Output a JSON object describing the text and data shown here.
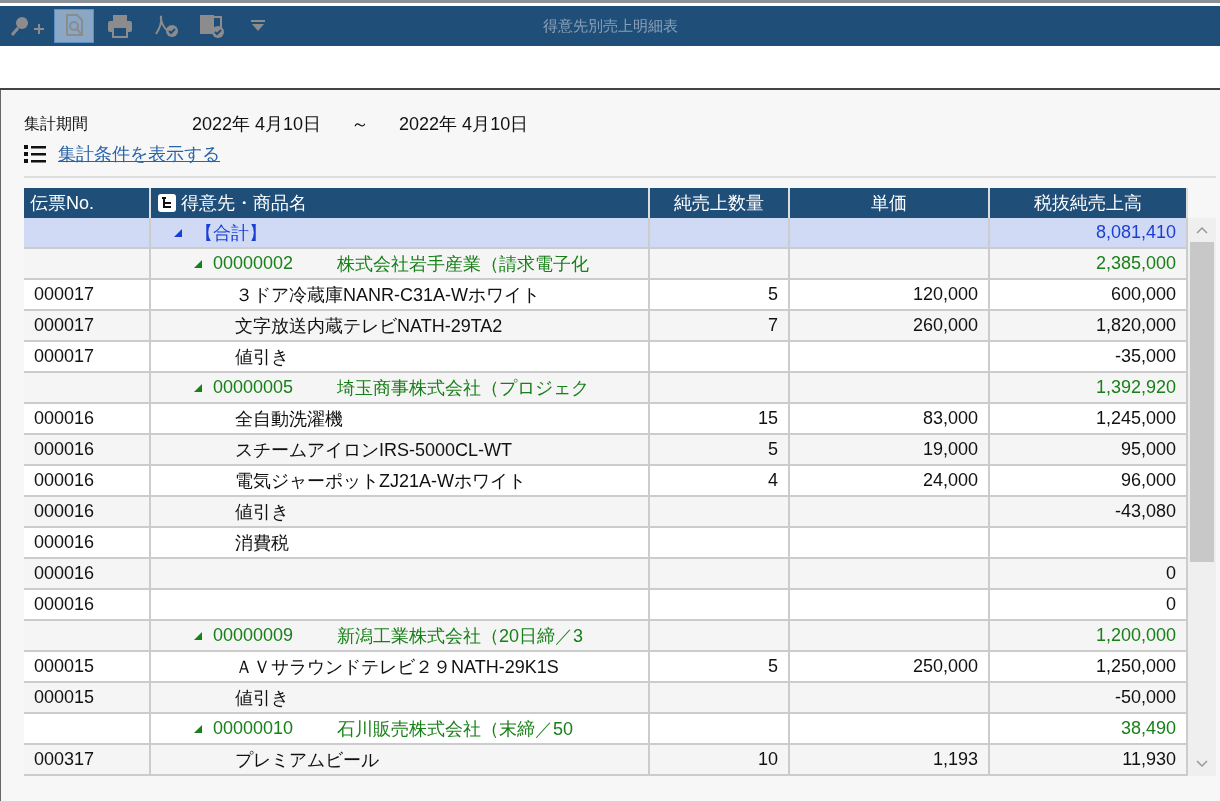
{
  "window": {
    "title": "得意先別売上明細表"
  },
  "toolbar": [
    {
      "kind": "zoom",
      "selected": false
    },
    {
      "kind": "preview",
      "selected": true
    },
    {
      "kind": "print",
      "selected": false
    },
    {
      "kind": "pdf",
      "selected": false
    },
    {
      "kind": "excel",
      "selected": false
    },
    {
      "kind": "more",
      "selected": false
    }
  ],
  "period": {
    "label": "集計期間",
    "from": "2022年  4月10日",
    "separator": "～",
    "to": "2022年  4月10日"
  },
  "conditions_link": "集計条件を表示する",
  "table": {
    "columns": [
      "伝票No.",
      "得意先・商品名",
      "純売上数量",
      "単価",
      "税抜純売上高"
    ],
    "rows": [
      {
        "kind": "total",
        "slip": "",
        "code": "",
        "name": "【合計】",
        "qty": "",
        "price": "",
        "amount": "8,081,410",
        "expanded": true
      },
      {
        "kind": "group",
        "slip": "",
        "code": "00000002",
        "name": "株式会社岩手産業（請求電子化",
        "qty": "",
        "price": "",
        "amount": "2,385,000",
        "expanded": true
      },
      {
        "kind": "item",
        "slip": "000017",
        "code": "",
        "name": "３ドア冷蔵庫NANR-C31A-Wホワイト",
        "qty": "5",
        "price": "120,000",
        "amount": "600,000"
      },
      {
        "kind": "item",
        "slip": "000017",
        "code": "",
        "name": "文字放送内蔵テレビNATH-29TA2",
        "qty": "7",
        "price": "260,000",
        "amount": "1,820,000"
      },
      {
        "kind": "item",
        "slip": "000017",
        "code": "",
        "name": "値引き",
        "qty": "",
        "price": "",
        "amount": "-35,000"
      },
      {
        "kind": "group",
        "slip": "",
        "code": "00000005",
        "name": "埼玉商事株式会社（プロジェク",
        "qty": "",
        "price": "",
        "amount": "1,392,920",
        "expanded": true
      },
      {
        "kind": "item",
        "slip": "000016",
        "code": "",
        "name": "全自動洗濯機",
        "qty": "15",
        "price": "83,000",
        "amount": "1,245,000"
      },
      {
        "kind": "item",
        "slip": "000016",
        "code": "",
        "name": "スチームアイロンIRS-5000CL-WT",
        "qty": "5",
        "price": "19,000",
        "amount": "95,000"
      },
      {
        "kind": "item",
        "slip": "000016",
        "code": "",
        "name": "電気ジャーポットZJ21A-Wホワイト",
        "qty": "4",
        "price": "24,000",
        "amount": "96,000"
      },
      {
        "kind": "item",
        "slip": "000016",
        "code": "",
        "name": "値引き",
        "qty": "",
        "price": "",
        "amount": "-43,080"
      },
      {
        "kind": "item",
        "slip": "000016",
        "code": "",
        "name": "消費税",
        "qty": "",
        "price": "",
        "amount": ""
      },
      {
        "kind": "item",
        "slip": "000016",
        "code": "",
        "name": "",
        "qty": "",
        "price": "",
        "amount": "0"
      },
      {
        "kind": "item",
        "slip": "000016",
        "code": "",
        "name": "",
        "qty": "",
        "price": "",
        "amount": "0"
      },
      {
        "kind": "group",
        "slip": "",
        "code": "00000009",
        "name": "新潟工業株式会社（20日締／3",
        "qty": "",
        "price": "",
        "amount": "1,200,000",
        "expanded": true
      },
      {
        "kind": "item",
        "slip": "000015",
        "code": "",
        "name": "ＡＶサラウンドテレビ２９NATH-29K1S",
        "qty": "5",
        "price": "250,000",
        "amount": "1,250,000"
      },
      {
        "kind": "item",
        "slip": "000015",
        "code": "",
        "name": "値引き",
        "qty": "",
        "price": "",
        "amount": "-50,000"
      },
      {
        "kind": "group",
        "slip": "",
        "code": "00000010",
        "name": "石川販売株式会社（末締／50",
        "qty": "",
        "price": "",
        "amount": "38,490",
        "expanded": true
      },
      {
        "kind": "item",
        "slip": "000317",
        "code": "",
        "name": "プレミアムビール",
        "qty": "10",
        "price": "1,193",
        "amount": "11,930"
      }
    ]
  }
}
